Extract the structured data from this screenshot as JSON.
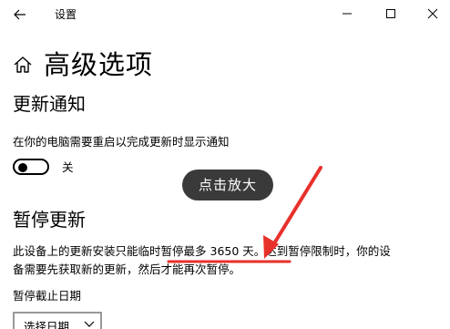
{
  "window": {
    "title": "设置"
  },
  "header": {
    "title": "高级选项"
  },
  "update_notify": {
    "heading": "更新通知",
    "description": "在你的电脑需要重启以完成更新时显示通知",
    "toggle_state": "关"
  },
  "overlay": {
    "zoom_hint": "点击放大"
  },
  "pause_updates": {
    "heading": "暂停更新",
    "text_before": "此设备上的更新安装只能临时",
    "text_highlight": "暂停最多 3650 天。",
    "text_after_line1": "达到暂停限制时，你的设",
    "text_line2": "备需要先获取新的更新，然后才能再次暂停。",
    "date_label": "暂停截止日期",
    "date_select_value": "选择日期"
  },
  "colors": {
    "annotation_red": "#e8302a",
    "tooltip_bg": "#3a3a3a"
  },
  "icons": {
    "back": "back-arrow-icon",
    "home": "home-icon",
    "minimize": "minimize-icon",
    "maximize": "maximize-icon",
    "close": "close-icon",
    "chevron": "chevron-down-icon"
  }
}
